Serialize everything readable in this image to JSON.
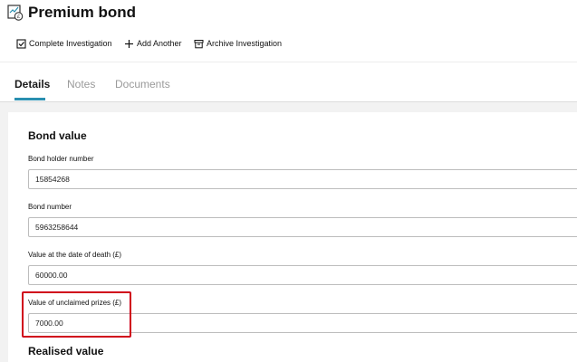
{
  "header": {
    "title": "Premium bond",
    "icon": "bond-document-icon"
  },
  "toolbar": {
    "complete_label": "Complete Investigation",
    "complete_icon": "checkbox-icon",
    "add_label": "Add Another",
    "add_icon": "plus-icon",
    "archive_label": "Archive Investigation",
    "archive_icon": "archive-box-icon"
  },
  "tabs": [
    {
      "label": "Details",
      "active": true
    },
    {
      "label": "Notes",
      "active": false
    },
    {
      "label": "Documents",
      "active": false
    }
  ],
  "bond_value": {
    "title": "Bond value",
    "fields": [
      {
        "label": "Bond holder number",
        "value": "15854268"
      },
      {
        "label": "Bond number",
        "value": "5963258644"
      },
      {
        "label": "Value at the date of death (£)",
        "value": "60000.00"
      },
      {
        "label": "Value of unclaimed prizes (£)",
        "value": "7000.00"
      }
    ]
  },
  "realised_value": {
    "title": "Realised value"
  },
  "colors": {
    "accent": "#2a8fb0",
    "highlight": "#d0021b"
  }
}
